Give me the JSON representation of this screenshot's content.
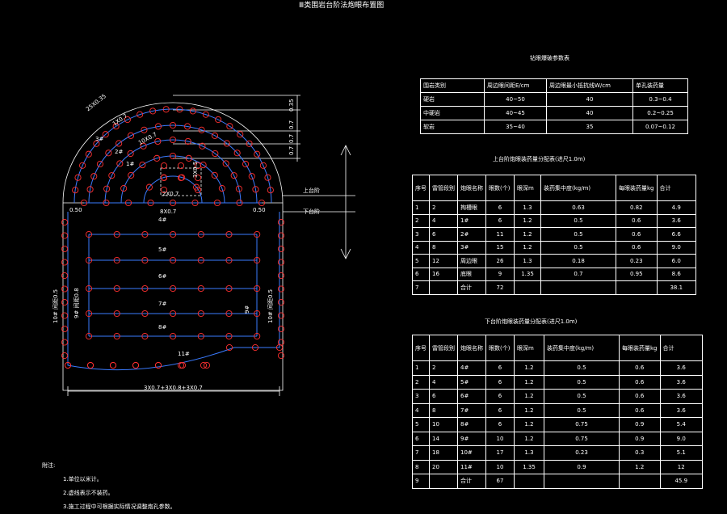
{
  "title": "Ⅲ类围岩台阶法炮眼布置图",
  "params_table": {
    "title": "钻眼爆破参数表",
    "headers": [
      "围岩类别",
      "周边眼间距E/cm",
      "周边眼最小抵抗线W/cm",
      "单孔装药量"
    ],
    "rows": [
      [
        "硬岩",
        "40~50",
        "40",
        "0.3~0.4"
      ],
      [
        "中硬岩",
        "40~45",
        "40",
        "0.2~0.25"
      ],
      [
        "软岩",
        "35~40",
        "35",
        "0.07~0.12"
      ]
    ]
  },
  "upper_table": {
    "title": "上台阶炮眼装药量分配表(进尺1.0m)",
    "headers": [
      "序号",
      "雷管段别",
      "炮眼名称",
      "眼数(个)",
      "眼深m",
      "装药集中度(kg/m)",
      "每眼装药量kg",
      "合计"
    ],
    "rows": [
      [
        "1",
        "2",
        "掏槽眼",
        "6",
        "1.3",
        "0.63",
        "0.82",
        "4.9"
      ],
      [
        "2",
        "4",
        "1#",
        "6",
        "1.2",
        "0.5",
        "0.6",
        "3.6"
      ],
      [
        "3",
        "6",
        "2#",
        "11",
        "1.2",
        "0.5",
        "0.6",
        "6.6"
      ],
      [
        "4",
        "8",
        "3#",
        "15",
        "1.2",
        "0.5",
        "0.6",
        "9.0"
      ],
      [
        "5",
        "12",
        "周边眼",
        "26",
        "1.3",
        "0.18",
        "0.23",
        "6.0"
      ],
      [
        "6",
        "16",
        "底眼",
        "9",
        "1.35",
        "0.7",
        "0.95",
        "8.6"
      ],
      [
        "7",
        "",
        "合计",
        "72",
        "",
        "",
        "",
        "38.1"
      ]
    ]
  },
  "lower_table": {
    "title": "下台阶炮眼装药量分配表(进尺1.0m)",
    "headers": [
      "序号",
      "雷管段别",
      "炮眼名称",
      "眼数(个)",
      "眼深m",
      "装药集中度(kg/m)",
      "每眼装药量kg",
      "合计"
    ],
    "rows": [
      [
        "1",
        "2",
        "4#",
        "6",
        "1.2",
        "0.5",
        "0.6",
        "3.6"
      ],
      [
        "2",
        "4",
        "5#",
        "6",
        "1.2",
        "0.5",
        "0.6",
        "3.6"
      ],
      [
        "3",
        "6",
        "6#",
        "6",
        "1.2",
        "0.5",
        "0.6",
        "3.6"
      ],
      [
        "4",
        "8",
        "7#",
        "6",
        "1.2",
        "0.5",
        "0.6",
        "3.6"
      ],
      [
        "5",
        "10",
        "8#",
        "6",
        "1.2",
        "0.75",
        "0.9",
        "5.4"
      ],
      [
        "6",
        "14",
        "9#",
        "10",
        "1.2",
        "0.75",
        "0.9",
        "9.0"
      ],
      [
        "7",
        "18",
        "10#",
        "17",
        "1.3",
        "0.23",
        "0.3",
        "5.1"
      ],
      [
        "8",
        "20",
        "11#",
        "10",
        "1.35",
        "0.9",
        "1.2",
        "12"
      ],
      [
        "9",
        "",
        "合计",
        "67",
        "",
        "",
        "",
        "45.9"
      ]
    ]
  },
  "drawing_labels": {
    "arc1": "25X0.35",
    "arc2": "1X0.7",
    "arc3": "10X0.7",
    "n1": "1#",
    "n2": "2#",
    "n3": "3#",
    "cut_h": "2X0.7",
    "cut_v": "3X0.5",
    "left_gap": "0.50",
    "right_gap": "0.50",
    "mid_bottom": "8X0.7",
    "row4": "4#",
    "row5": "5#",
    "row6": "6#",
    "row7": "7#",
    "row8": "8#",
    "row11": "11#",
    "left_side": "10#  间距0.5",
    "left_inner": "9#  间距0.8",
    "right_side": "10#  间距0.5",
    "right_inner": "9#",
    "bottom_dim": "3X0.7+3X0.8+3X0.7",
    "upper_bench": "上台阶",
    "lower_bench": "下台阶",
    "dim1": "0.35",
    "dim2": "0.7",
    "dim3": "0.7",
    "dim4": "0.7"
  },
  "notes": {
    "heading": "附注:",
    "items": [
      "1.单位以米计。",
      "2.虚线表示不装药。",
      "3.施工过程中可根据实际情况调整炮孔参数。"
    ]
  },
  "colors": {
    "background": "#000000",
    "line": "#ffffff",
    "hole": "#ff3030",
    "contour": "#3a7bff"
  }
}
